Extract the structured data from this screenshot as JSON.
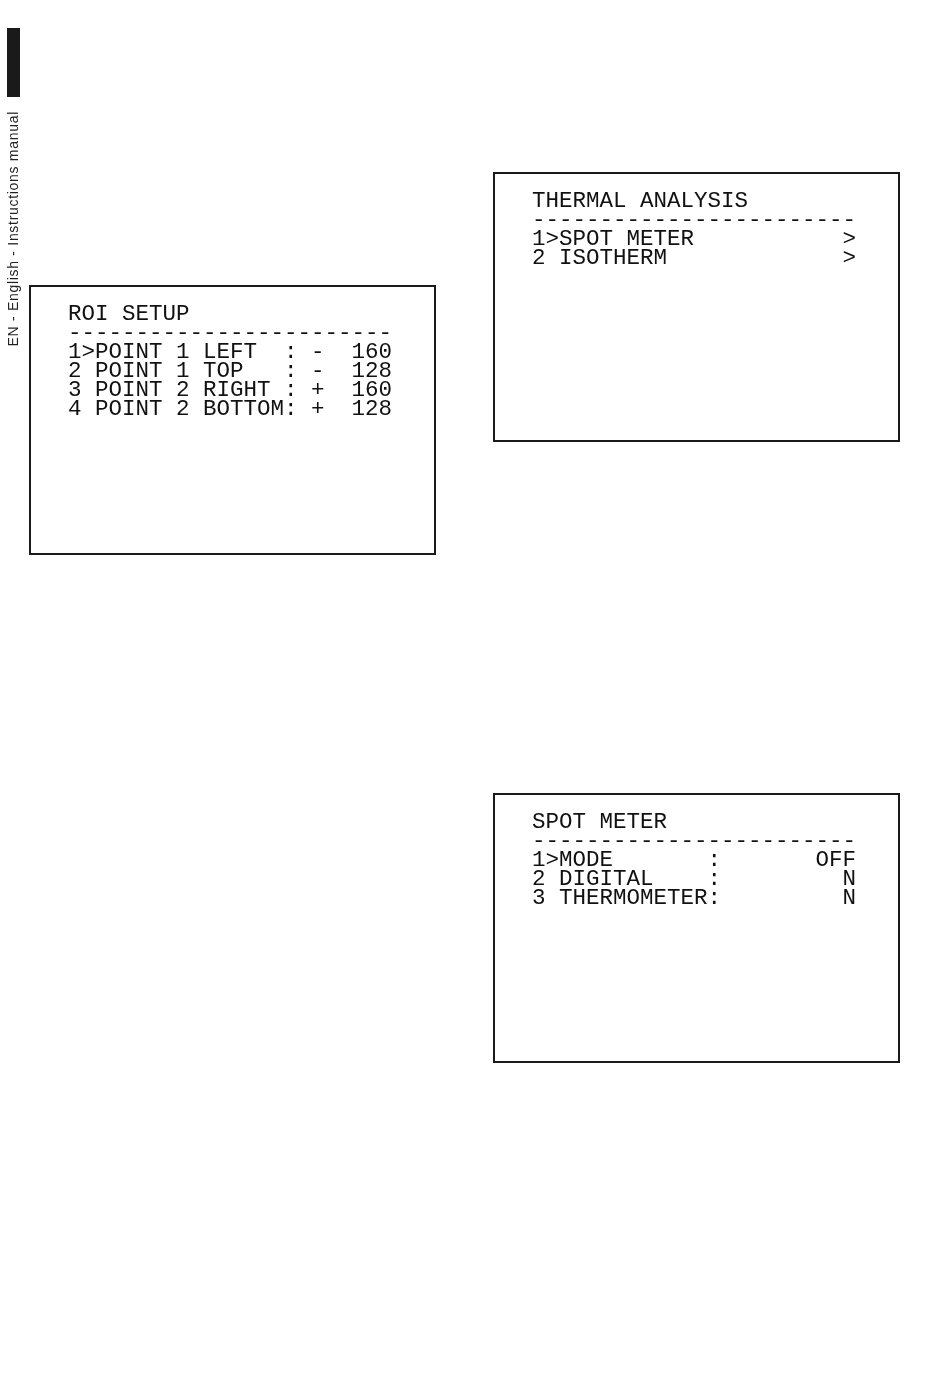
{
  "page_margin": {
    "label": "EN - English - Instructions manual"
  },
  "columns": [
    {
      "menus": [
        {
          "kind": "signed",
          "title": "ROI SETUP",
          "rule": "------------------------",
          "cursor": ">",
          "items": [
            {
              "number": "1",
              "label": "POINT 1 LEFT",
              "separator": ":",
              "sign": "-",
              "value": "160",
              "selected": true
            },
            {
              "number": "2",
              "label": "POINT 1 TOP",
              "separator": ":",
              "sign": "-",
              "value": "128",
              "selected": false
            },
            {
              "number": "3",
              "label": "POINT 2 RIGHT",
              "separator": ":",
              "sign": "+",
              "value": "160",
              "selected": false
            },
            {
              "number": "4",
              "label": "POINT 2 BOTTOM",
              "separator": ":",
              "sign": "+",
              "value": "128",
              "selected": false
            }
          ]
        }
      ]
    },
    {
      "menus": [
        {
          "kind": "submenu",
          "title": "THERMAL ANALYSIS",
          "rule": "------------------------",
          "cursor": ">",
          "items": [
            {
              "number": "1",
              "label": "SPOT METER",
              "value": ">",
              "selected": true
            },
            {
              "number": "2",
              "label": "ISOTHERM",
              "value": ">",
              "selected": false
            }
          ]
        },
        {
          "kind": "value",
          "title": "SPOT METER",
          "rule": "------------------------",
          "cursor": ">",
          "items": [
            {
              "number": "1",
              "label": "MODE",
              "separator": ":",
              "value": "OFF",
              "selected": true
            },
            {
              "number": "2",
              "label": "DIGITAL",
              "separator": ":",
              "value": "N",
              "selected": false
            },
            {
              "number": "3",
              "label": "THERMOMETER",
              "separator": ":",
              "value": "N",
              "selected": false
            }
          ]
        }
      ]
    }
  ]
}
